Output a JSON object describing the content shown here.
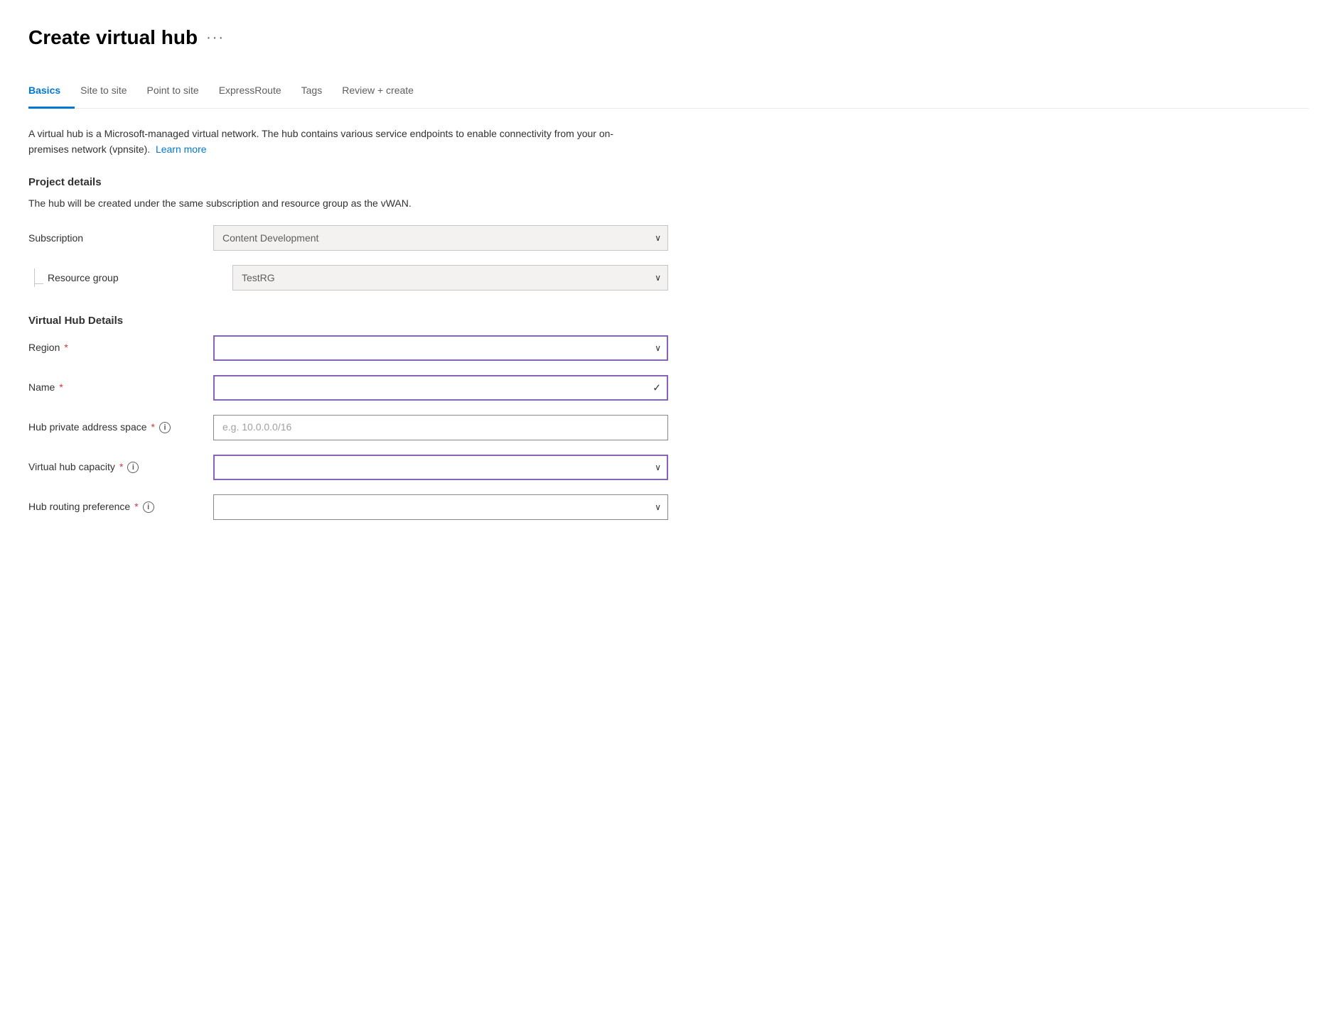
{
  "page": {
    "title": "Create virtual hub",
    "ellipsis": "···"
  },
  "tabs": {
    "items": [
      {
        "id": "basics",
        "label": "Basics",
        "active": true
      },
      {
        "id": "site-to-site",
        "label": "Site to site",
        "active": false
      },
      {
        "id": "point-to-site",
        "label": "Point to site",
        "active": false
      },
      {
        "id": "expressroute",
        "label": "ExpressRoute",
        "active": false
      },
      {
        "id": "tags",
        "label": "Tags",
        "active": false
      },
      {
        "id": "review-create",
        "label": "Review + create",
        "active": false
      }
    ]
  },
  "description": {
    "main": "A virtual hub is a Microsoft-managed virtual network. The hub contains various service endpoints to enable connectivity from your on-premises network (vpnsite).",
    "learn_more": "Learn more"
  },
  "project_details": {
    "heading": "Project details",
    "subtext": "The hub will be created under the same subscription and resource group as the vWAN.",
    "subscription_label": "Subscription",
    "subscription_value": "Content Development",
    "resource_group_label": "Resource group",
    "resource_group_value": "TestRG"
  },
  "virtual_hub_details": {
    "heading": "Virtual Hub Details",
    "fields": [
      {
        "id": "region",
        "label": "Region",
        "required": true,
        "has_info": false,
        "type": "select-active",
        "value": "",
        "placeholder": "",
        "icon": "chevron"
      },
      {
        "id": "name",
        "label": "Name",
        "required": true,
        "has_info": false,
        "type": "select-active-check",
        "value": "",
        "placeholder": "",
        "icon": "check"
      },
      {
        "id": "hub-private-address-space",
        "label": "Hub private address space",
        "required": true,
        "has_info": true,
        "type": "input",
        "value": "",
        "placeholder": "e.g. 10.0.0.0/16",
        "icon": ""
      },
      {
        "id": "virtual-hub-capacity",
        "label": "Virtual hub capacity",
        "required": true,
        "has_info": true,
        "type": "select-active",
        "value": "",
        "placeholder": "",
        "icon": "chevron"
      },
      {
        "id": "hub-routing-preference",
        "label": "Hub routing preference",
        "required": true,
        "has_info": true,
        "type": "select-normal",
        "value": "",
        "placeholder": "",
        "icon": "chevron"
      }
    ]
  },
  "icons": {
    "chevron_down": "∨",
    "check": "✓",
    "info": "i"
  }
}
